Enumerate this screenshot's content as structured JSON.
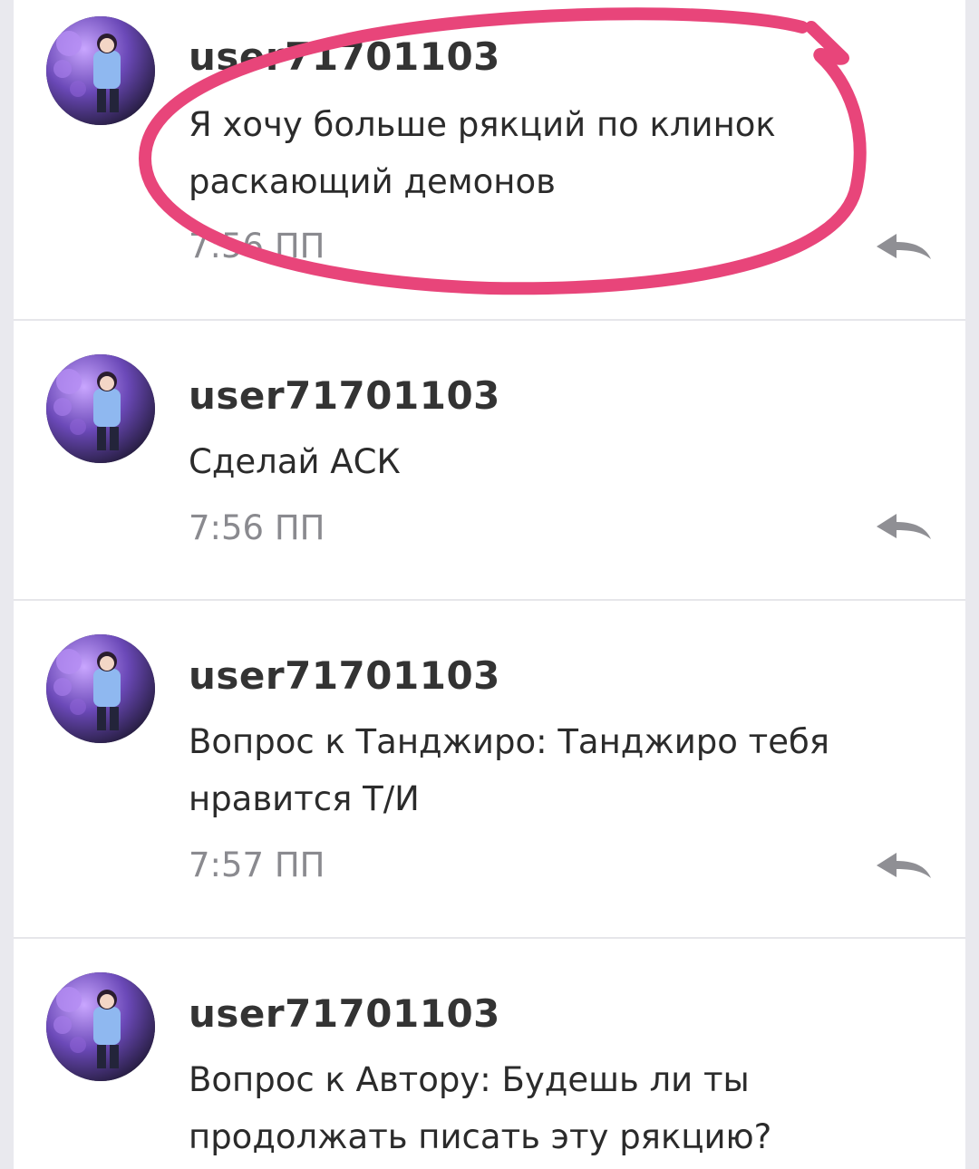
{
  "colors": {
    "highlight_stroke": "#e8457a",
    "username": "#333333",
    "time": "#8a8a8f"
  },
  "comments": [
    {
      "username": "user71701103",
      "text": "Я хочу больше рякций по клинок раскающий демонов",
      "time": "7:56 ПП",
      "avatar_icon": "avatar-anime-character",
      "reply_icon": "reply-arrow-icon"
    },
    {
      "username": "user71701103",
      "text": "Сделай АСК",
      "time": "7:56 ПП",
      "avatar_icon": "avatar-anime-character",
      "reply_icon": "reply-arrow-icon"
    },
    {
      "username": "user71701103",
      "text": "Вопрос к Танджиро: Танджиро тебя нравится Т/И",
      "time": "7:57 ПП",
      "avatar_icon": "avatar-anime-character",
      "reply_icon": "reply-arrow-icon"
    },
    {
      "username": "user71701103",
      "text": "Вопрос к Автору: Будешь ли ты продолжать писать эту рякцию?",
      "avatar_icon": "avatar-anime-character"
    }
  ]
}
